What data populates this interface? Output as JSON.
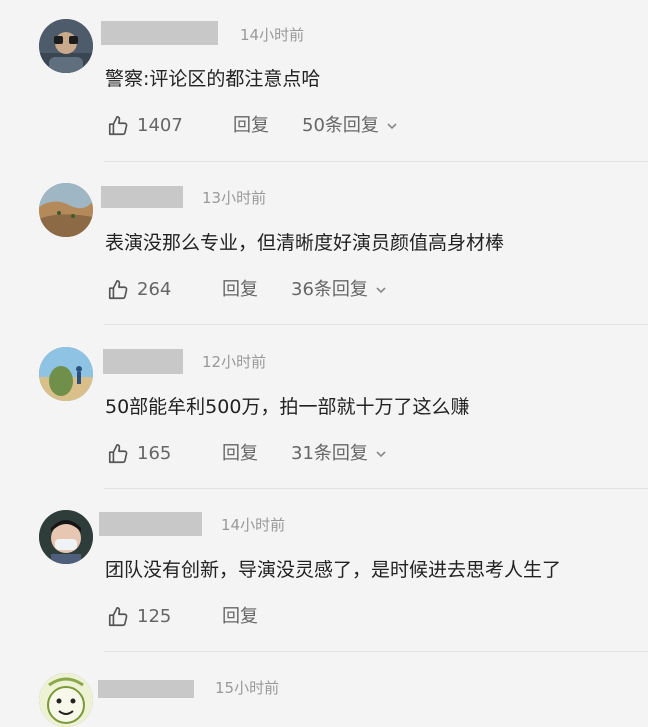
{
  "comments": [
    {
      "time": "14小时前",
      "text": "警察:评论区的都注意点哈",
      "likes": "1407",
      "reply": "回复",
      "more": "50条回复",
      "avatar": "binoculars-man-avatar"
    },
    {
      "time": "13小时前",
      "text": "表演没那么专业，但清晰度好演员颜值高身材棒",
      "likes": "264",
      "reply": "回复",
      "more": "36条回复",
      "avatar": "desert-landscape-avatar"
    },
    {
      "time": "12小时前",
      "text": "50部能牟利500万，拍一部就十万了这么赚",
      "likes": "165",
      "reply": "回复",
      "more": "31条回复",
      "avatar": "beach-scene-avatar"
    },
    {
      "time": "14小时前",
      "text": "团队没有创新，导演没灵感了，是时候进去思考人生了",
      "likes": "125",
      "reply": "回复",
      "more": "",
      "avatar": "masked-person-avatar"
    },
    {
      "time": "15小时前",
      "text": "",
      "likes": "",
      "reply": "",
      "more": "",
      "avatar": "cartoon-avatar"
    }
  ],
  "colors": {
    "background": "#f4f4f4",
    "text": "#222222",
    "muted": "#999999",
    "action": "#666666"
  }
}
